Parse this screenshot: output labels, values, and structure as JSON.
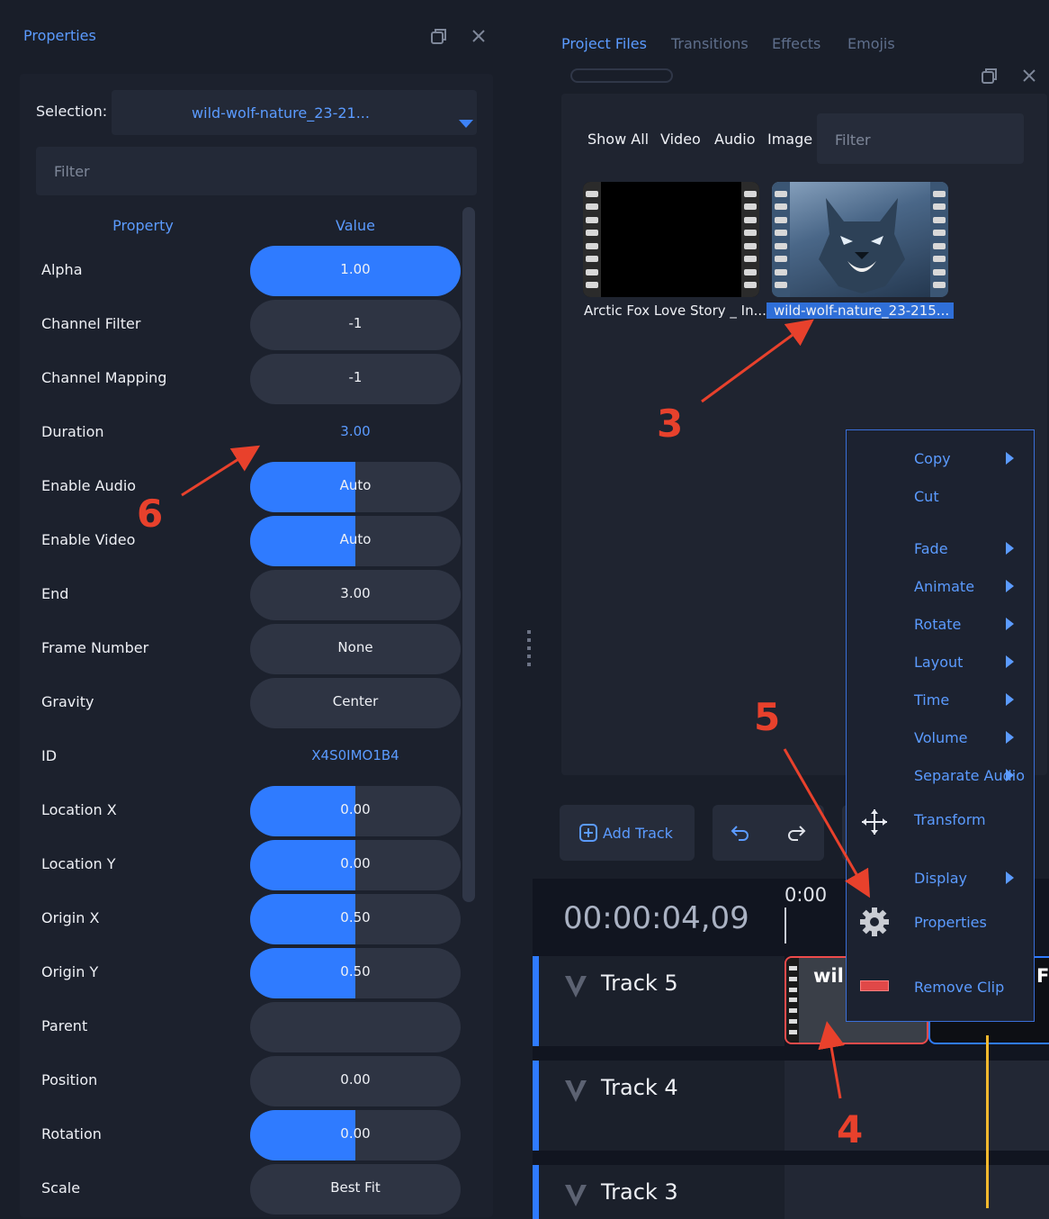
{
  "left_panel": {
    "title": "Properties",
    "selection_label": "Selection:",
    "selection_value": "wild-wolf-nature_23-21...",
    "filter_placeholder": "Filter",
    "header_property": "Property",
    "header_value": "Value",
    "rows": [
      {
        "label": "Alpha",
        "value": "1.00",
        "style": "slider",
        "fill": 1.0
      },
      {
        "label": "Channel Filter",
        "value": "-1",
        "style": "pill"
      },
      {
        "label": "Channel Mapping",
        "value": "-1",
        "style": "pill"
      },
      {
        "label": "Duration",
        "value": "3.00",
        "style": "plain"
      },
      {
        "label": "Enable Audio",
        "value": "Auto",
        "style": "slider",
        "fill": 0.5
      },
      {
        "label": "Enable Video",
        "value": "Auto",
        "style": "slider",
        "fill": 0.5
      },
      {
        "label": "End",
        "value": "3.00",
        "style": "pill"
      },
      {
        "label": "Frame Number",
        "value": "None",
        "style": "pill"
      },
      {
        "label": "Gravity",
        "value": "Center",
        "style": "pill"
      },
      {
        "label": "ID",
        "value": "X4S0IMO1B4",
        "style": "plain"
      },
      {
        "label": "Location X",
        "value": "0.00",
        "style": "slider",
        "fill": 0.5
      },
      {
        "label": "Location Y",
        "value": "0.00",
        "style": "slider",
        "fill": 0.5
      },
      {
        "label": "Origin X",
        "value": "0.50",
        "style": "slider",
        "fill": 0.5
      },
      {
        "label": "Origin Y",
        "value": "0.50",
        "style": "slider",
        "fill": 0.5
      },
      {
        "label": "Parent",
        "value": "",
        "style": "pill"
      },
      {
        "label": "Position",
        "value": "0.00",
        "style": "pill"
      },
      {
        "label": "Rotation",
        "value": "0.00",
        "style": "slider",
        "fill": 0.5
      },
      {
        "label": "Scale",
        "value": "Best Fit",
        "style": "pill"
      }
    ]
  },
  "right_panel": {
    "tabs": [
      "Project Files",
      "Transitions",
      "Effects",
      "Emojis"
    ],
    "file_tabs": [
      "Show All",
      "Video",
      "Audio",
      "Image"
    ],
    "filter_placeholder": "Filter",
    "files": [
      {
        "name": "Arctic Fox Love Story _ In..."
      },
      {
        "name": "wild-wolf-nature_23-215..."
      }
    ]
  },
  "toolbar": {
    "add_track": "Add Track"
  },
  "timeline": {
    "timecode": "00:00:04,09",
    "ruler_start": "0:00",
    "tracks": [
      "Track 5",
      "Track 4",
      "Track 3"
    ],
    "clip_label": "wil",
    "clip2_label": "F"
  },
  "context_menu": {
    "items": [
      {
        "label": "Copy",
        "submenu": true
      },
      {
        "label": "Cut",
        "submenu": false
      },
      {
        "label": "Fade",
        "submenu": true
      },
      {
        "label": "Animate",
        "submenu": true
      },
      {
        "label": "Rotate",
        "submenu": true
      },
      {
        "label": "Layout",
        "submenu": true
      },
      {
        "label": "Time",
        "submenu": true
      },
      {
        "label": "Volume",
        "submenu": true
      },
      {
        "label": "Separate Audio",
        "submenu": true
      },
      {
        "label": "Transform",
        "submenu": false
      },
      {
        "label": "Display",
        "submenu": true
      },
      {
        "label": "Properties",
        "submenu": false
      },
      {
        "label": "Remove Clip",
        "submenu": false
      }
    ]
  },
  "annotations": [
    "3",
    "4",
    "5",
    "6"
  ],
  "colors": {
    "accent": "#2f7bff",
    "link": "#5b9bff",
    "annotation": "#e8412c",
    "playhead": "#f5b92e"
  }
}
